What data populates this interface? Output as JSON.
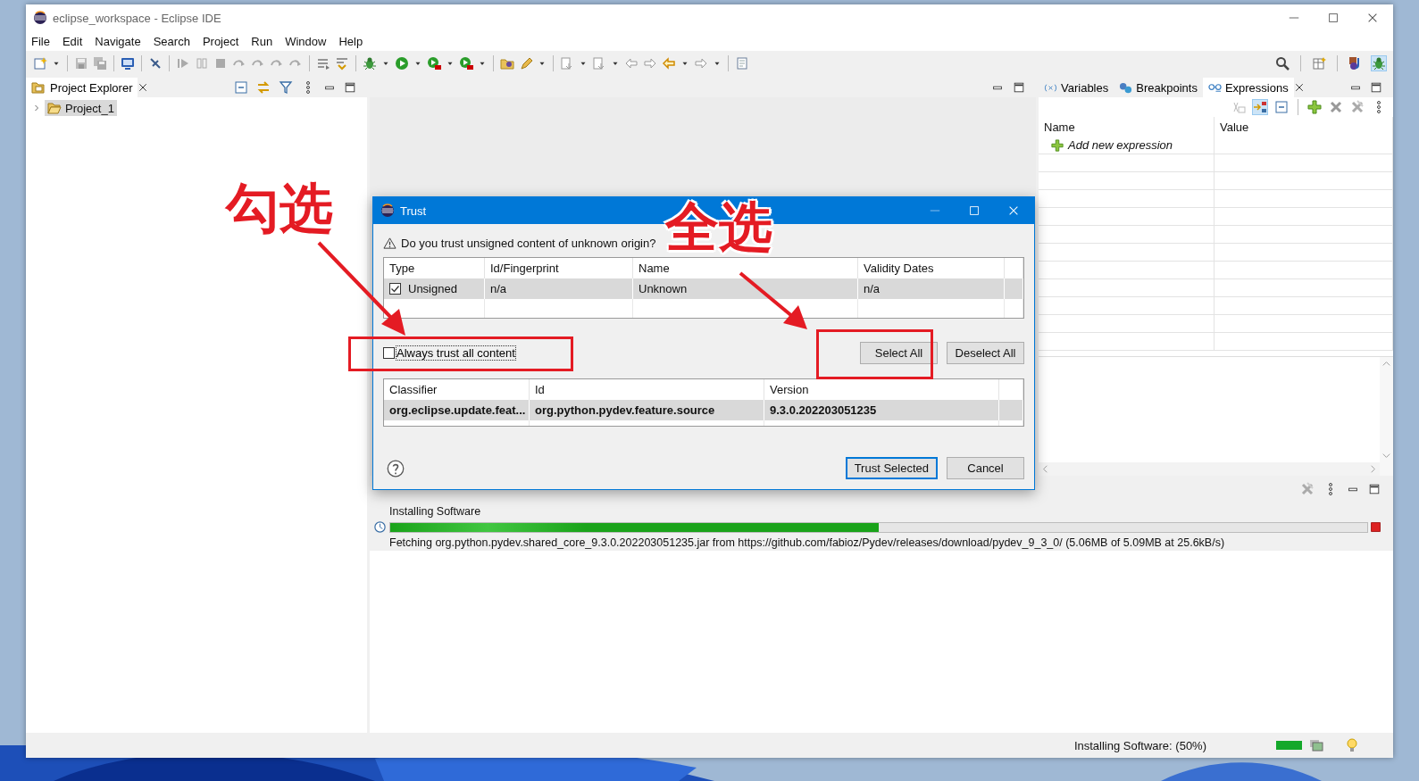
{
  "window": {
    "title": "eclipse_workspace - Eclipse IDE"
  },
  "menu": [
    "File",
    "Edit",
    "Navigate",
    "Search",
    "Project",
    "Run",
    "Window",
    "Help"
  ],
  "project_explorer": {
    "title": "Project Explorer",
    "items": [
      {
        "label": "Project_1",
        "selected": true
      }
    ]
  },
  "debug_views": {
    "tabs": [
      {
        "label": "Variables",
        "selected": false
      },
      {
        "label": "Breakpoints",
        "selected": false
      },
      {
        "label": "Expressions",
        "selected": true
      }
    ],
    "columns": [
      "Name",
      "Value"
    ],
    "add_row": "Add new expression"
  },
  "dialog": {
    "title": "Trust",
    "question": "Do you trust unsigned content of unknown origin?",
    "signers": {
      "columns": [
        "Type",
        "Id/Fingerprint",
        "Name",
        "Validity Dates"
      ],
      "rows": [
        {
          "checked": true,
          "selected": true,
          "cells": [
            "Unsigned",
            "n/a",
            "Unknown",
            "n/a"
          ]
        }
      ]
    },
    "always_trust": {
      "label": "Always trust all content",
      "checked": false
    },
    "selection_buttons": [
      "Select All",
      "Deselect All"
    ],
    "artifacts": {
      "columns": [
        "Classifier",
        "Id",
        "Version"
      ],
      "rows": [
        {
          "selected": true,
          "cells": [
            "org.eclipse.update.feat...",
            "org.python.pydev.feature.source",
            "9.3.0.202203051235"
          ]
        }
      ]
    },
    "footer_buttons": [
      {
        "label": "Trust Selected",
        "default": true
      },
      {
        "label": "Cancel",
        "default": false
      }
    ]
  },
  "progress": {
    "title": "Installing Software",
    "level": 0.5,
    "detail": "Fetching org.python.pydev.shared_core_9.3.0.202203051235.jar from https://github.com/fabioz/Pydev/releases/download/pydev_9_3_0/ (5.06MB of 5.09MB at 25.6kB/s)"
  },
  "status_bar": {
    "text": "Installing Software: (50%)"
  },
  "annotations": [
    {
      "text": "勾选"
    },
    {
      "text": "全选"
    }
  ]
}
